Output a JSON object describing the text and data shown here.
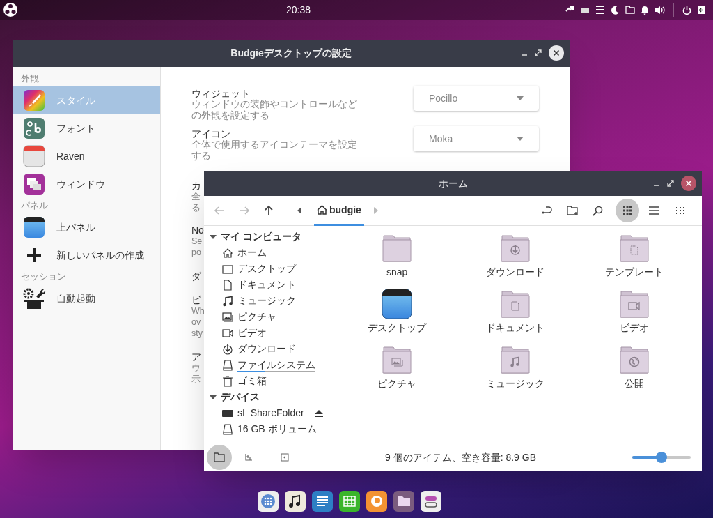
{
  "top_panel": {
    "clock": "20:38"
  },
  "settings_window": {
    "title": "Budgieデスクトップの設定",
    "sidebar": [
      {
        "heading": "外観",
        "items": [
          {
            "label": "スタイル",
            "kind": "style",
            "selected": true
          },
          {
            "label": "フォント",
            "kind": "font",
            "selected": false
          },
          {
            "label": "Raven",
            "kind": "raven",
            "selected": false
          },
          {
            "label": "ウィンドウ",
            "kind": "window",
            "selected": false
          }
        ]
      },
      {
        "heading": "パネル",
        "items": [
          {
            "label": "上パネル",
            "kind": "panel",
            "selected": false
          },
          {
            "label": "新しいパネルの作成",
            "kind": "add",
            "selected": false
          }
        ]
      },
      {
        "heading": "セッション",
        "items": [
          {
            "label": "自動起動",
            "kind": "autostart",
            "selected": false
          }
        ]
      }
    ],
    "settings": [
      {
        "title": "ウィジェット",
        "description": "ウィンドウの装飾やコントロールなどの外観を設定する",
        "value": "Pocillo"
      },
      {
        "title": "アイコン",
        "description": "全体で使用するアイコンテーマを設定する",
        "value": "Moka"
      }
    ],
    "covered_rows": [
      {
        "lines": [
          "カ",
          "全",
          "る"
        ]
      },
      {
        "lines": [
          "No",
          "Se",
          "po"
        ]
      },
      {
        "lines": [
          "ダ"
        ]
      },
      {
        "lines": [
          "ビ",
          "Wh",
          "ov",
          "sty"
        ]
      },
      {
        "lines": [
          "ア",
          "ウ",
          "示"
        ]
      }
    ]
  },
  "file_window": {
    "title": "ホーム",
    "path": "budgie",
    "views": [
      {
        "kind": "icons",
        "selected": true
      },
      {
        "kind": "list",
        "selected": false
      },
      {
        "kind": "compact",
        "selected": false
      }
    ],
    "places": [
      {
        "heading": "マイ コンピュータ",
        "expanded": true,
        "items": [
          {
            "label": "ホーム",
            "kind": "home"
          },
          {
            "label": "デスクトップ",
            "kind": "desktop"
          },
          {
            "label": "ドキュメント",
            "kind": "document"
          },
          {
            "label": "ミュージック",
            "kind": "music"
          },
          {
            "label": "ピクチャ",
            "kind": "pictures"
          },
          {
            "label": "ビデオ",
            "kind": "video"
          },
          {
            "label": "ダウンロード",
            "kind": "download"
          },
          {
            "label": "ファイルシステム",
            "kind": "drive",
            "level": 0.35
          },
          {
            "label": "ゴミ箱",
            "kind": "trash"
          }
        ]
      },
      {
        "heading": "デバイス",
        "expanded": true,
        "items": [
          {
            "label": "sf_ShareFolder",
            "kind": "share",
            "ejectable": true
          },
          {
            "label": "16 GB ボリューム",
            "kind": "drive"
          }
        ]
      }
    ],
    "files": [
      {
        "name": "snap",
        "kind": "folder"
      },
      {
        "name": "ダウンロード",
        "kind": "download"
      },
      {
        "name": "テンプレート",
        "kind": "template"
      },
      {
        "name": "デスクトップ",
        "kind": "desktop"
      },
      {
        "name": "ドキュメント",
        "kind": "document"
      },
      {
        "name": "ビデオ",
        "kind": "video"
      },
      {
        "name": "ピクチャ",
        "kind": "pictures"
      },
      {
        "name": "ミュージック",
        "kind": "music"
      },
      {
        "name": "公開",
        "kind": "public"
      }
    ],
    "status": "9 個のアイテム、空き容量: 8.9 GB",
    "zoom": {
      "level": 0.5
    }
  }
}
